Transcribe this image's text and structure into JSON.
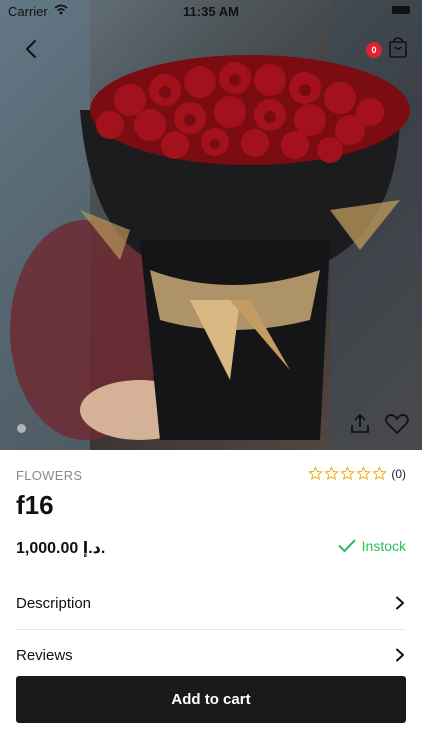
{
  "status_bar": {
    "carrier": "Carrier",
    "time": "11:35 AM"
  },
  "header": {
    "cart_count": "0"
  },
  "product": {
    "category": "FLOWERS",
    "title": "f16",
    "price": "1,000.00 د.إ.",
    "rating_count": "(0)",
    "rating_value": 0,
    "rating_max": 5,
    "stock_status": "Instock"
  },
  "sections": {
    "description_label": "Description",
    "reviews_label": "Reviews"
  },
  "actions": {
    "add_to_cart_label": "Add to cart"
  },
  "colors": {
    "accent": "#2fbf58",
    "star": "#e6b422",
    "badge": "#e0212f",
    "button": "#1a1a1a"
  },
  "icons": [
    "back-icon",
    "cart-icon",
    "share-icon",
    "heart-icon",
    "star-icon",
    "check-icon",
    "chevron-right-icon",
    "wifi-icon",
    "battery-icon"
  ]
}
